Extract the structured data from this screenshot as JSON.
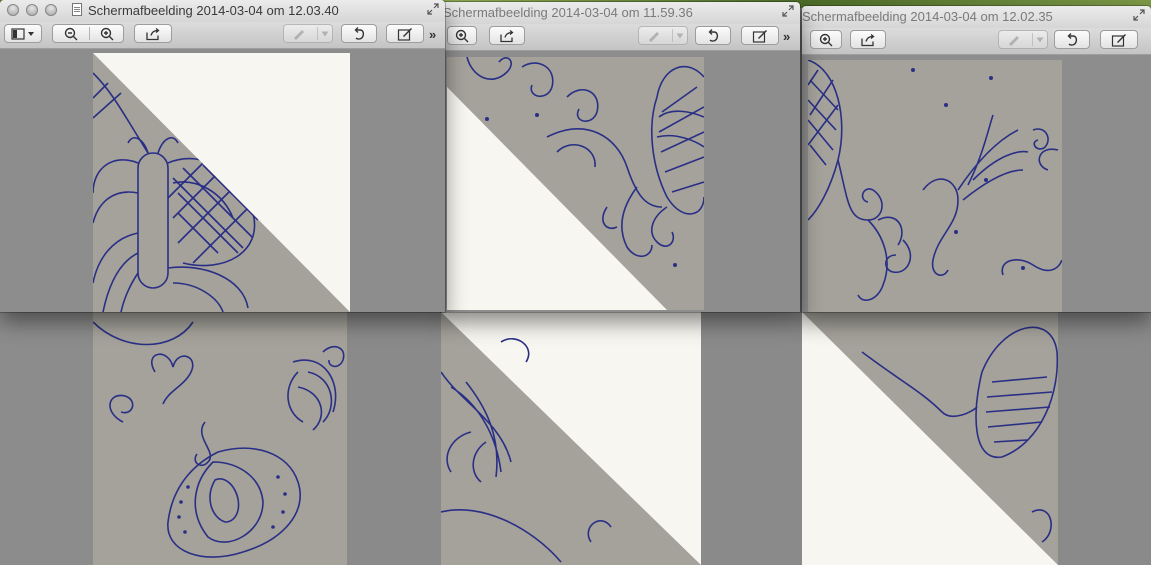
{
  "windows": [
    {
      "title": "Schermafbeelding 2014-03-04 om 12.03.40",
      "state": "active",
      "toolbar": {
        "sidebar_button": "sidebar-icon",
        "zoom_out_button": "zoom-out-icon",
        "zoom_in_button": "zoom-in-icon",
        "share_button": "share-icon",
        "annotate_button": "pen-icon",
        "rotate_button": "rotate-icon",
        "edit_button": "edit-icon",
        "overflow": "»"
      }
    },
    {
      "title": "Schermafbeelding 2014-03-04 om 11.59.36",
      "state": "inactive",
      "toolbar": {
        "zoom_in_button": "zoom-in-icon",
        "share_button": "share-icon",
        "annotate_button": "pen-icon",
        "rotate_button": "rotate-icon",
        "edit_button": "edit-icon",
        "overflow": "»"
      }
    },
    {
      "title": "Schermafbeelding 2014-03-04 om 12.02.35",
      "state": "inactive",
      "toolbar": {
        "zoom_in_button": "zoom-in-icon",
        "share_button": "share-icon",
        "annotate_button": "pen-icon",
        "rotate_button": "rotate-icon",
        "edit_button": "edit-icon",
        "overflow": "»"
      }
    }
  ],
  "colors": {
    "paper_gray": "#a6a49c",
    "paper_white": "#f7f6f0",
    "ink_blue": "#2a2f86",
    "window_bg": "#8d8d8d"
  }
}
